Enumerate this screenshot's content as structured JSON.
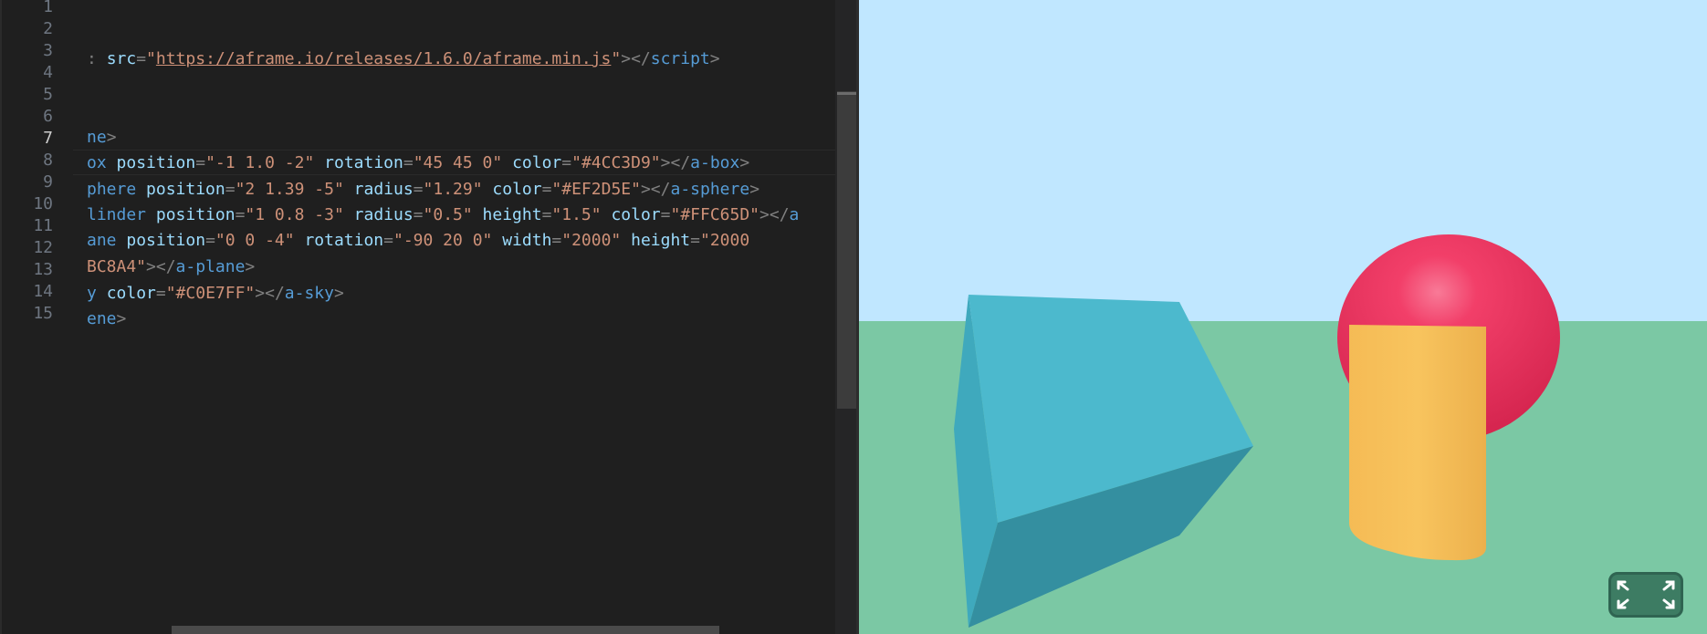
{
  "editor": {
    "line_numbers": [
      "1",
      "2",
      "3",
      "4",
      "5",
      "6",
      "7",
      "8",
      "9",
      "10",
      "11",
      "12",
      "13",
      "14",
      "15"
    ],
    "active_line": "7",
    "lines": {
      "l3": {
        "pre": ": ",
        "attr_src": "src",
        "eq": "=",
        "q1": "\"",
        "url": "https://aframe.io/releases/1.6.0/aframe.min.js",
        "q2": "\"",
        "close_open": "></",
        "close_tag": "script",
        "close_gt": ">"
      },
      "l6": {
        "tag": "ne",
        "gt": ">"
      },
      "l7": {
        "tag": "ox",
        "a1": "position",
        "v1": "\"-1 1.0 -2\"",
        "a2": "rotation",
        "v2": "\"45 45 0\"",
        "a3": "color",
        "v3": "\"#4CC3D9\"",
        "close_open": "></",
        "close_tag": "a-box",
        "close_gt": ">"
      },
      "l8": {
        "tag": "phere",
        "a1": "position",
        "v1": "\"2 1.39 -5\"",
        "a2": "radius",
        "v2": "\"1.29\"",
        "a3": "color",
        "v3": "\"#EF2D5E\"",
        "close_open": "></",
        "close_tag": "a-sphere",
        "close_gt": ">"
      },
      "l9": {
        "tag": "linder",
        "a1": "position",
        "v1": "\"1 0.8 -3\"",
        "a2": "radius",
        "v2": "\"0.5\"",
        "a3": "height",
        "v3": "\"1.5\"",
        "a4": "color",
        "v4": "\"#FFC65D\"",
        "close_open": "></",
        "close_tag": "a"
      },
      "l10": {
        "tag": "ane",
        "a1": "position",
        "v1": "\"0 0 -4\"",
        "a2": "rotation",
        "v2": "\"-90 20 0\"",
        "a3": "width",
        "v3": "\"2000\"",
        "a4": "height",
        "v4": "\"2000"
      },
      "l11": {
        "v": "BC8A4\"",
        "close_open": "></",
        "close_tag": "a-plane",
        "close_gt": ">"
      },
      "l12": {
        "tag": "y",
        "a1": "color",
        "v1": "\"#C0E7FF\"",
        "close_open": "></",
        "close_tag": "a-sky",
        "close_gt": ">"
      },
      "l13": {
        "tag": "ene",
        "gt": ">"
      }
    }
  },
  "scene": {
    "sky_color": "#C0E7FF",
    "ground_color": "#7BC8A4",
    "box_color": "#4CC3D9",
    "sphere_color": "#EF2D5E",
    "cylinder_color": "#FFC65D"
  },
  "fullscreen_button": {
    "icon": "fullscreen-icon",
    "color": "#3d7c63"
  }
}
